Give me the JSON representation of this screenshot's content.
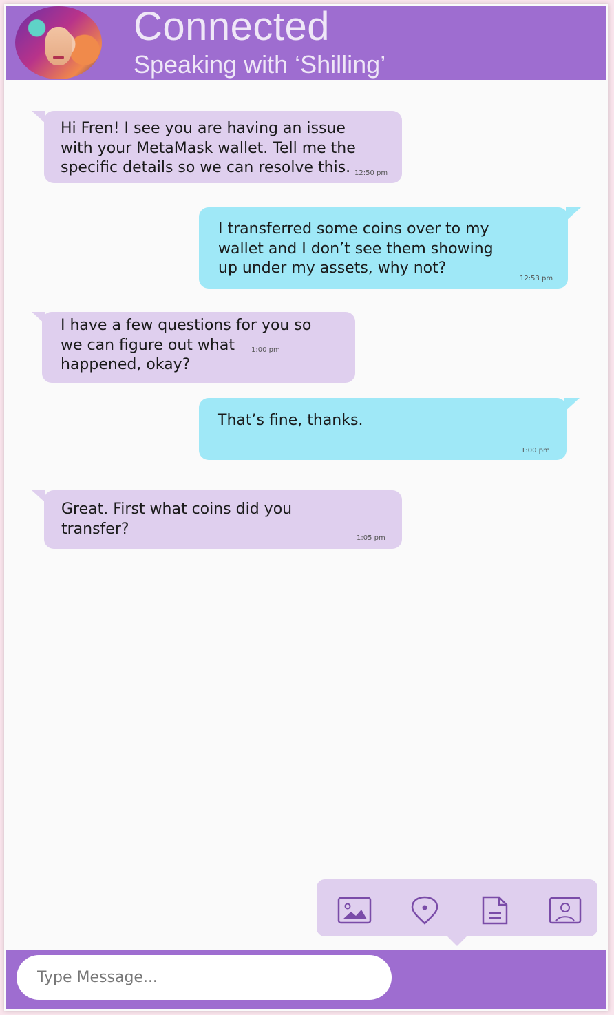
{
  "header": {
    "title": "Connected",
    "subtitle": "Speaking with ‘Shilling’"
  },
  "messages": [
    {
      "from": "agent",
      "text": "Hi Fren! I see you are having an issue\nwith your MetaMask wallet.  Tell me the\nspecific details so we can resolve this.",
      "time": "12:50 pm"
    },
    {
      "from": "user",
      "text": "I transferred some coins over to my\nwallet and I don’t see them showing\nup under my assets, why not?",
      "time": "12:53 pm"
    },
    {
      "from": "agent",
      "text": "I have a few questions for you so\nwe can figure out what\nhappened, okay?",
      "time": "1:00 pm"
    },
    {
      "from": "user",
      "text": "That’s fine, thanks.",
      "time": "1:00 pm"
    },
    {
      "from": "agent",
      "text": "Great. First what coins did you\ntransfer?",
      "time": "1:05 pm"
    }
  ],
  "attachments": [
    {
      "icon": "image-icon"
    },
    {
      "icon": "location-pin-icon"
    },
    {
      "icon": "document-icon"
    },
    {
      "icon": "contact-card-icon"
    }
  ],
  "composer": {
    "placeholder": "Type Message..."
  },
  "colors": {
    "header": "#9e6dd0",
    "agent_bubble": "#dfcfee",
    "user_bubble": "#9fe8f7",
    "background": "#fafafa",
    "icon": "#7a4ca8"
  }
}
